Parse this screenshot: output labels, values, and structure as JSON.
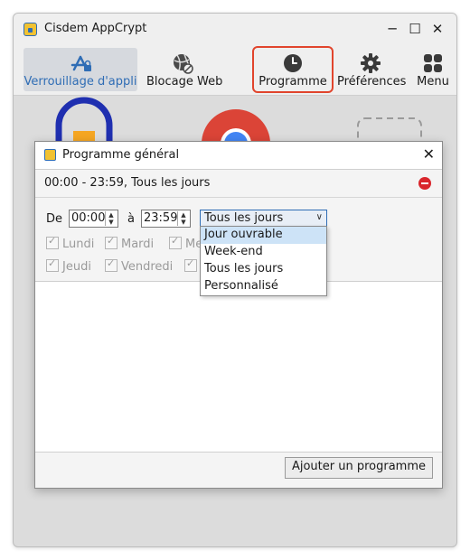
{
  "window": {
    "title": "Cisdem AppCrypt"
  },
  "toolbar": {
    "items": [
      {
        "label": "Verrouillage d'appli",
        "icon": "app-store-lock-icon",
        "active": true
      },
      {
        "label": "Blocage Web",
        "icon": "globe-block-icon"
      },
      {
        "label": "Programme",
        "icon": "clock-icon",
        "highlighted": true
      },
      {
        "label": "Préférences",
        "icon": "gear-icon"
      },
      {
        "label": "Menu",
        "icon": "grid-menu-icon"
      }
    ]
  },
  "dialog": {
    "title": "Programme général",
    "schedule_entry": "00:00 - 23:59, Tous les jours",
    "from_label": "De",
    "from_time": "00:00",
    "to_label": "à",
    "to_time": "23:59",
    "repeat_selected": "Tous les jours",
    "days": [
      "Lundi",
      "Mardi",
      "Me",
      "Jeudi",
      "Vendredi"
    ],
    "dropdown_options": [
      "Jour ouvrable",
      "Week-end",
      "Tous les jours",
      "Personnalisé"
    ],
    "add_button": "Ajouter un programme"
  },
  "colors": {
    "accent": "#2f6db5",
    "highlight": "#e1452d",
    "selected_option": "#cde3f7",
    "remove": "#d9262c"
  }
}
